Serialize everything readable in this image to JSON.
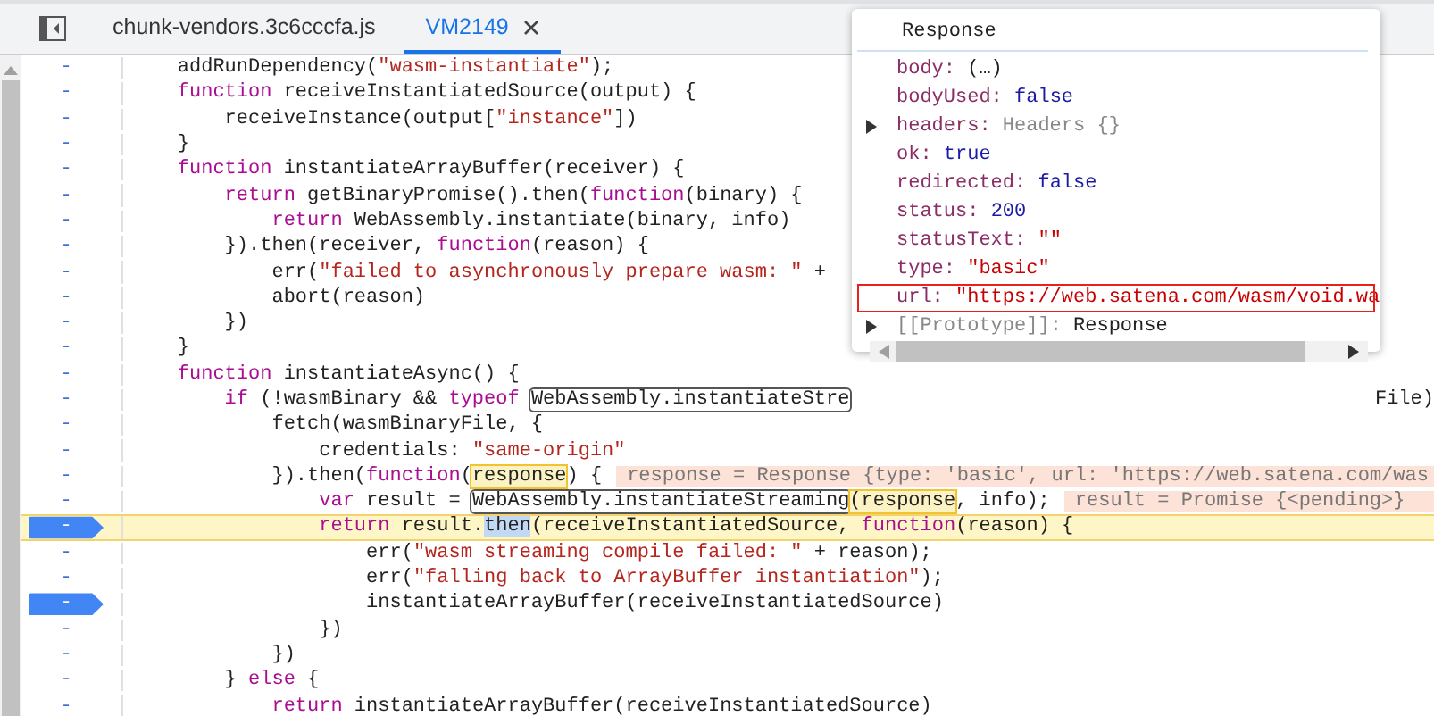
{
  "tabs": [
    {
      "label": "chunk-vendors.3c6cccfa.js",
      "selected": false,
      "closable": false
    },
    {
      "label": "VM2149",
      "selected": true,
      "closable": true
    }
  ],
  "gutter_mark": "-",
  "code_lines": [
    {
      "breakpoint": false,
      "current": false,
      "tokens": [
        {
          "kind": "plain",
          "text": "    addRunDependency("
        },
        {
          "kind": "str",
          "text": "\"wasm-instantiate\""
        },
        {
          "kind": "plain",
          "text": ");"
        }
      ]
    },
    {
      "breakpoint": false,
      "current": false,
      "tokens": [
        {
          "kind": "kw",
          "text": "    function"
        },
        {
          "kind": "plain",
          "text": " receiveInstantiatedSource(output) {"
        }
      ]
    },
    {
      "breakpoint": false,
      "current": false,
      "tokens": [
        {
          "kind": "plain",
          "text": "        receiveInstance(output["
        },
        {
          "kind": "str",
          "text": "\"instance\""
        },
        {
          "kind": "plain",
          "text": "])"
        }
      ]
    },
    {
      "breakpoint": false,
      "current": false,
      "tokens": [
        {
          "kind": "plain",
          "text": "    }"
        }
      ]
    },
    {
      "breakpoint": false,
      "current": false,
      "tokens": [
        {
          "kind": "kw",
          "text": "    function"
        },
        {
          "kind": "plain",
          "text": " instantiateArrayBuffer(receiver) {"
        }
      ]
    },
    {
      "breakpoint": false,
      "current": false,
      "tokens": [
        {
          "kind": "kw",
          "text": "        return"
        },
        {
          "kind": "plain",
          "text": " getBinaryPromise().then("
        },
        {
          "kind": "kw",
          "text": "function"
        },
        {
          "kind": "plain",
          "text": "(binary) {"
        }
      ]
    },
    {
      "breakpoint": false,
      "current": false,
      "tokens": [
        {
          "kind": "kw",
          "text": "            return"
        },
        {
          "kind": "plain",
          "text": " WebAssembly.instantiate(binary, info)"
        }
      ]
    },
    {
      "breakpoint": false,
      "current": false,
      "tokens": [
        {
          "kind": "plain",
          "text": "        }).then(receiver, "
        },
        {
          "kind": "kw",
          "text": "function"
        },
        {
          "kind": "plain",
          "text": "(reason) {"
        }
      ]
    },
    {
      "breakpoint": false,
      "current": false,
      "tokens": [
        {
          "kind": "plain",
          "text": "            err("
        },
        {
          "kind": "str",
          "text": "\"failed to asynchronously prepare wasm: \""
        },
        {
          "kind": "plain",
          "text": " +"
        }
      ]
    },
    {
      "breakpoint": false,
      "current": false,
      "tokens": [
        {
          "kind": "plain",
          "text": "            abort(reason)"
        }
      ]
    },
    {
      "breakpoint": false,
      "current": false,
      "tokens": [
        {
          "kind": "plain",
          "text": "        })"
        }
      ]
    },
    {
      "breakpoint": false,
      "current": false,
      "tokens": [
        {
          "kind": "plain",
          "text": "    }"
        }
      ]
    },
    {
      "breakpoint": false,
      "current": false,
      "tokens": [
        {
          "kind": "kw",
          "text": "    function"
        },
        {
          "kind": "plain",
          "text": " instantiateAsync() {"
        }
      ]
    },
    {
      "breakpoint": false,
      "current": false,
      "tokens": [
        {
          "kind": "kw",
          "text": "        if"
        },
        {
          "kind": "plain",
          "text": " (!wasmBinary && "
        },
        {
          "kind": "kw",
          "text": "typeof "
        },
        {
          "kind": "boxed",
          "text": "WebAssembly.instantiateStre"
        }
      ],
      "tail": "File)"
    },
    {
      "breakpoint": false,
      "current": false,
      "tokens": [
        {
          "kind": "plain",
          "text": "            fetch(wasmBinaryFile, {"
        }
      ]
    },
    {
      "breakpoint": false,
      "current": false,
      "tokens": [
        {
          "kind": "plain",
          "text": "                credentials: "
        },
        {
          "kind": "str",
          "text": "\"same-origin\""
        }
      ]
    },
    {
      "breakpoint": false,
      "current": false,
      "tokens": [
        {
          "kind": "plain",
          "text": "            }).then("
        },
        {
          "kind": "kw",
          "text": "function"
        },
        {
          "kind": "plain",
          "text": "("
        },
        {
          "kind": "hover",
          "text": "response"
        },
        {
          "kind": "plain",
          "text": ") {"
        }
      ],
      "inline_value": "response = Response {type: 'basic', url: 'https://web.satena.com/was"
    },
    {
      "breakpoint": false,
      "current": false,
      "tokens": [
        {
          "kind": "kw",
          "text": "                var"
        },
        {
          "kind": "plain",
          "text": " result = "
        },
        {
          "kind": "boxed",
          "text": "WebAssembly.instantiateStreaming"
        },
        {
          "kind": "hover",
          "text": "(response"
        },
        {
          "kind": "plain",
          "text": ", info);"
        }
      ],
      "inline_value": "result = Promise {<pending>}"
    },
    {
      "breakpoint": true,
      "current": true,
      "tokens": [
        {
          "kind": "kw",
          "text": "                return"
        },
        {
          "kind": "plain",
          "text": " result."
        },
        {
          "kind": "selected",
          "text": "then"
        },
        {
          "kind": "plain",
          "text": "(receiveInstantiatedSource, "
        },
        {
          "kind": "kw",
          "text": "function"
        },
        {
          "kind": "plain",
          "text": "(reason) {"
        }
      ]
    },
    {
      "breakpoint": false,
      "current": false,
      "tokens": [
        {
          "kind": "plain",
          "text": "                    err("
        },
        {
          "kind": "str",
          "text": "\"wasm streaming compile failed: \""
        },
        {
          "kind": "plain",
          "text": " + reason);"
        }
      ]
    },
    {
      "breakpoint": false,
      "current": false,
      "tokens": [
        {
          "kind": "plain",
          "text": "                    err("
        },
        {
          "kind": "str",
          "text": "\"falling back to ArrayBuffer instantiation\""
        },
        {
          "kind": "plain",
          "text": ");"
        }
      ]
    },
    {
      "breakpoint": true,
      "current": false,
      "tokens": [
        {
          "kind": "plain",
          "text": "                    instantiateArrayBuffer(receiveInstantiatedSource)"
        }
      ]
    },
    {
      "breakpoint": false,
      "current": false,
      "tokens": [
        {
          "kind": "plain",
          "text": "                })"
        }
      ]
    },
    {
      "breakpoint": false,
      "current": false,
      "tokens": [
        {
          "kind": "plain",
          "text": "            })"
        }
      ]
    },
    {
      "breakpoint": false,
      "current": false,
      "tokens": [
        {
          "kind": "plain",
          "text": "        } "
        },
        {
          "kind": "kw",
          "text": "else"
        },
        {
          "kind": "plain",
          "text": " {"
        }
      ]
    },
    {
      "breakpoint": false,
      "current": false,
      "tokens": [
        {
          "kind": "kw",
          "text": "            return"
        },
        {
          "kind": "plain",
          "text": " instantiateArrayBuffer(receiveInstantiatedSource)"
        }
      ]
    }
  ],
  "popover": {
    "title": "Response",
    "properties": [
      {
        "name": "body:",
        "value": "(…)",
        "kind": "plain",
        "expandable": false,
        "marked": false
      },
      {
        "name": "bodyUsed:",
        "value": "false",
        "kind": "keyword",
        "expandable": false,
        "marked": false
      },
      {
        "name": "headers:",
        "value": "Headers {}",
        "kind": "object",
        "expandable": true,
        "marked": false
      },
      {
        "name": "ok:",
        "value": "true",
        "kind": "keyword",
        "expandable": false,
        "marked": false
      },
      {
        "name": "redirected:",
        "value": "false",
        "kind": "keyword",
        "expandable": false,
        "marked": false
      },
      {
        "name": "status:",
        "value": "200",
        "kind": "number",
        "expandable": false,
        "marked": false
      },
      {
        "name": "statusText:",
        "value": "\"\"",
        "kind": "string",
        "expandable": false,
        "marked": false
      },
      {
        "name": "type:",
        "value": "\"basic\"",
        "kind": "string",
        "expandable": false,
        "marked": false
      },
      {
        "name": "url:",
        "value": "\"https://web.satena.com/wasm/void.wa",
        "kind": "string",
        "expandable": false,
        "marked": true
      },
      {
        "name": "[[Prototype]]:",
        "value": "Response",
        "kind": "internal",
        "expandable": true,
        "marked": false
      }
    ]
  }
}
